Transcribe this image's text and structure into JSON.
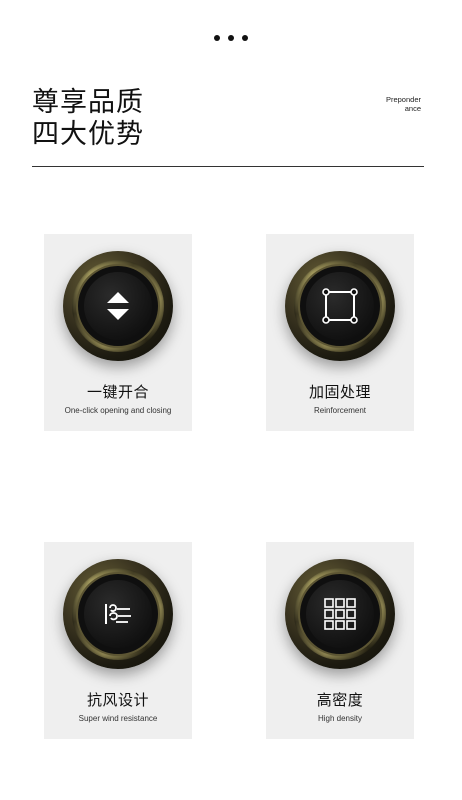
{
  "header": {
    "title_line1": "尊享品质",
    "title_line2": "四大优势",
    "side_tag_line1": "Preponder",
    "side_tag_line2": "ance"
  },
  "features": [
    {
      "title": "一键开合",
      "subtitle": "One-click opening and closing",
      "icon": "up-down-arrows-icon"
    },
    {
      "title": "加固处理",
      "subtitle": "Reinforcement",
      "icon": "reinforced-frame-icon"
    },
    {
      "title": "抗风设计",
      "subtitle": "Super wind resistance",
      "icon": "wind-icon"
    },
    {
      "title": "高密度",
      "subtitle": "High density",
      "icon": "grid-density-icon"
    }
  ],
  "colors": {
    "background": "#ffffff",
    "card": "#efefef",
    "knob_gold": "#8c8350",
    "knob_face": "#121212"
  }
}
